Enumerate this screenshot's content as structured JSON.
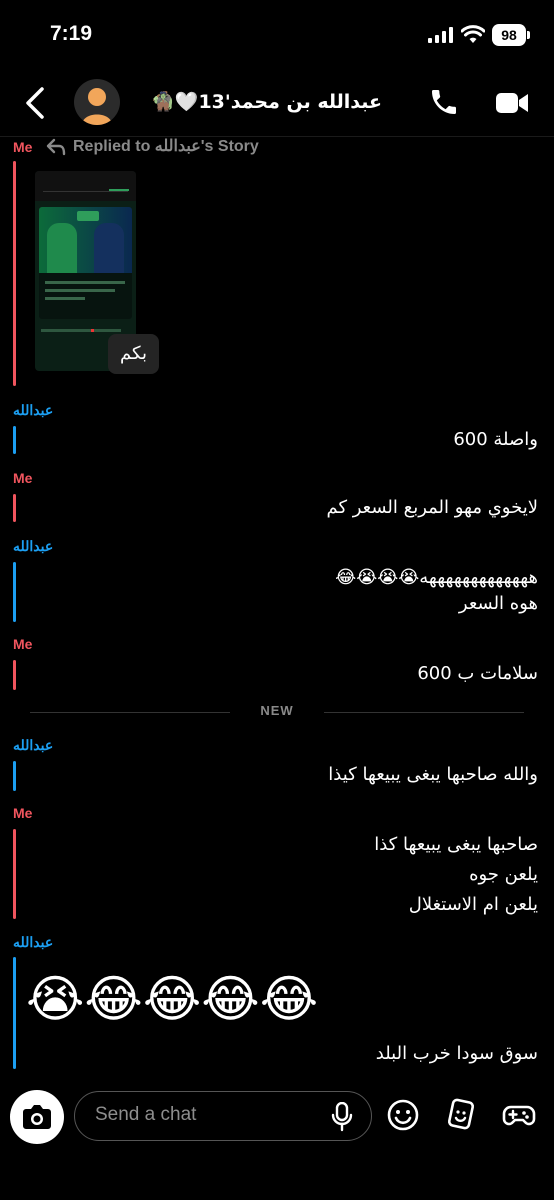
{
  "status_bar": {
    "time": "7:19",
    "battery": "98"
  },
  "header": {
    "title": "عبدالله بن محمد'13",
    "title_emoji": "🤍🧌"
  },
  "messages": [
    {
      "sender": "Me",
      "reply_note": "Replied to عبدالله's Story",
      "text": "بكم"
    },
    {
      "sender": "عبدالله",
      "text": "واصلة 600"
    },
    {
      "sender": "Me",
      "text": "لايخوي مهو المربع السعر كم"
    },
    {
      "sender": "عبدالله",
      "text": "هههههههههههههه😭😭😭😂\nهوه السعر"
    },
    {
      "sender": "Me",
      "text": "سلامات ب 600"
    },
    {
      "sender": "عبدالله",
      "text": "والله صاحبها يبغى يبيعها كيذا"
    },
    {
      "sender": "Me",
      "text": "صاحبها يبغى يبيعها كذا\nيلعن جوه\nيلعن ام الاستغلال"
    },
    {
      "sender": "عبدالله",
      "emojis": "😭😂😂😂😂",
      "text": "سوق سودا خرب البلد"
    }
  ],
  "divider": {
    "label": "NEW"
  },
  "composer": {
    "placeholder": "Send a chat"
  },
  "icons": {
    "back": "chevron-left-icon",
    "avatar": "bitmoji-avatar",
    "call": "phone-icon",
    "video": "video-camera-icon",
    "camera": "camera-icon",
    "mic": "microphone-icon",
    "emoji": "smiley-icon",
    "sticker": "sticker-icon",
    "games": "gamepad-icon"
  },
  "colors": {
    "me": "#f0555e",
    "them": "#1c9ff2",
    "background": "#000000"
  }
}
